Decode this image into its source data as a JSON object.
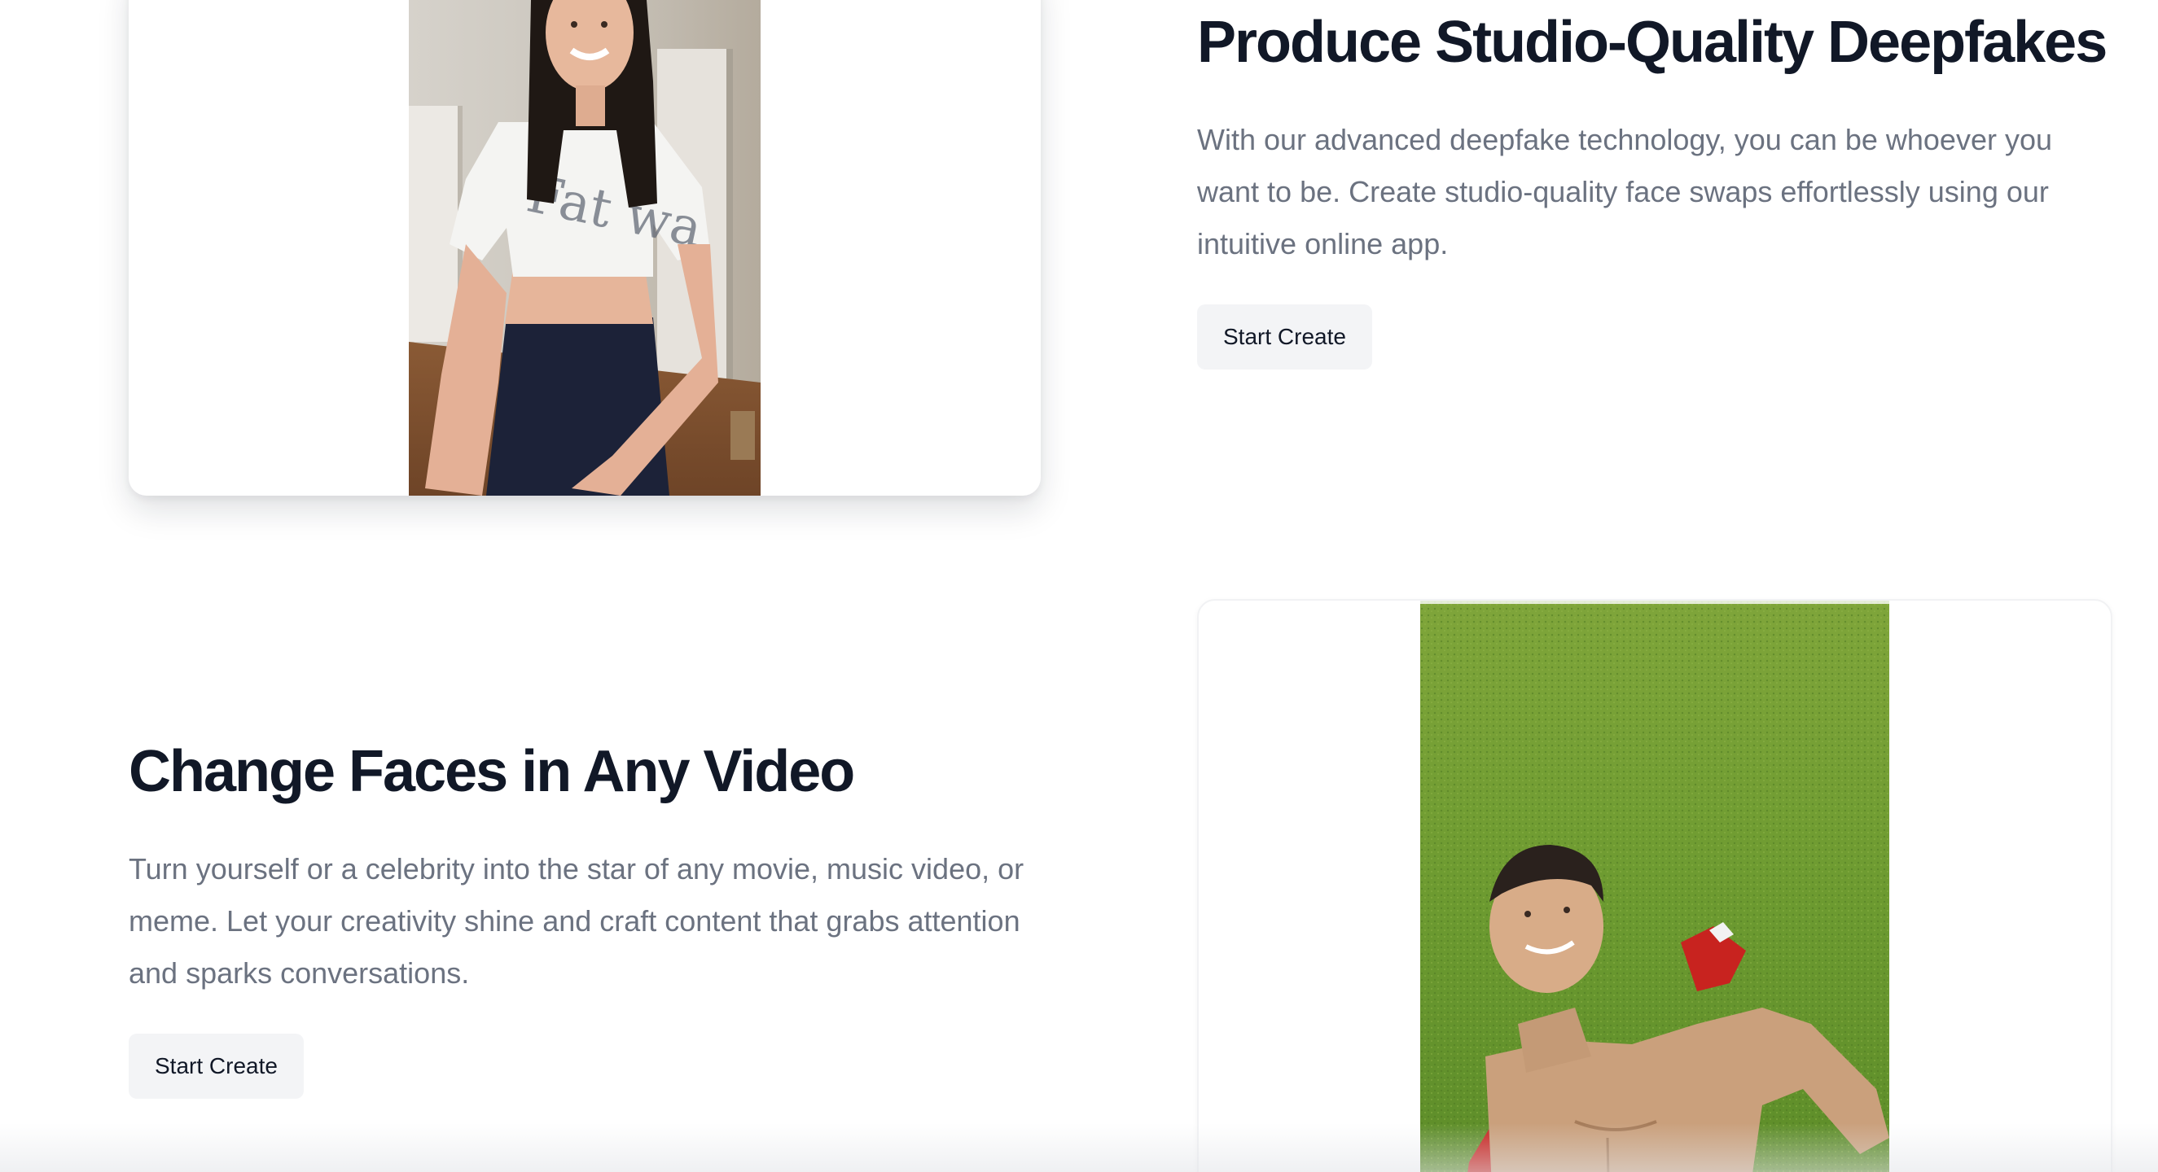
{
  "sections": [
    {
      "heading": "Produce Studio-Quality Deepfakes",
      "description": "With our advanced deepfake technology, you can be whoever you want to be. Create studio-quality face swaps effortlessly using our intuitive online app.",
      "cta_label": "Start Create",
      "media": "woman-dancing-video"
    },
    {
      "heading": "Change Faces in Any Video",
      "description": "Turn yourself or a celebrity into the star of any movie, music video, or meme. Let your creativity shine and craft content that grabs attention and sparks conversations.",
      "cta_label": "Start Create",
      "media": "soccer-player-video"
    }
  ],
  "colors": {
    "heading": "#111827",
    "body": "#6b7280",
    "button_bg": "#f3f4f6"
  }
}
